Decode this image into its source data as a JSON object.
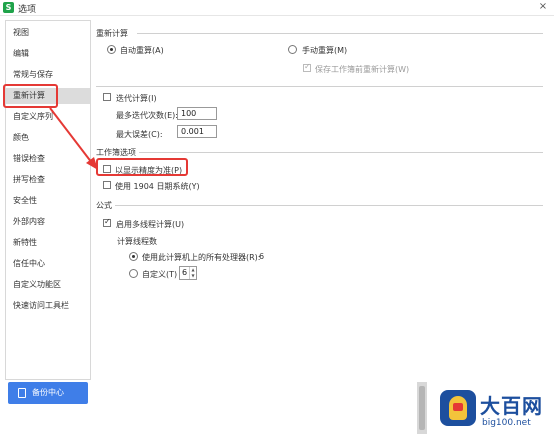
{
  "window": {
    "title": "选项",
    "app_icon_letter": "S",
    "close": "×"
  },
  "sidebar": {
    "items": [
      {
        "label": "视图",
        "active": false
      },
      {
        "label": "编辑",
        "active": false
      },
      {
        "label": "常规与保存",
        "active": false
      },
      {
        "label": "重新计算",
        "active": true
      },
      {
        "label": "自定义序列",
        "active": false
      },
      {
        "label": "颜色",
        "active": false
      },
      {
        "label": "错误检查",
        "active": false
      },
      {
        "label": "拼写检查",
        "active": false
      },
      {
        "label": "安全性",
        "active": false
      },
      {
        "label": "外部内容",
        "active": false
      },
      {
        "label": "新特性",
        "active": false
      },
      {
        "label": "信任中心",
        "active": false
      },
      {
        "label": "自定义功能区",
        "active": false
      },
      {
        "label": "快速访问工具栏",
        "active": false
      }
    ],
    "backup_button": "备份中心"
  },
  "recalc": {
    "title": "重新计算",
    "auto_label": "自动重算(A)",
    "auto_checked": true,
    "manual_label": "手动重算(M)",
    "manual_checked": false,
    "save_recalc_label": "保存工作簿前重新计算(W)",
    "save_recalc_checked": true
  },
  "iteration": {
    "label": "迭代计算(I)",
    "checked": false,
    "max_iter_label": "最多迭代次数(E):",
    "max_iter_value": "100",
    "max_change_label": "最大误差(C):",
    "max_change_value": "0.001"
  },
  "workbook": {
    "title": "工作簿选项",
    "precision_label": "以显示精度为准(P)",
    "precision_checked": false,
    "date1904_label": "使用 1904 日期系统(Y)",
    "date1904_checked": false
  },
  "formula": {
    "title": "公式",
    "multithread_label": "启用多线程计算(U)",
    "multithread_checked": true,
    "threads_title": "计算线程数",
    "all_proc_label": "使用此计算机上的所有处理器(R):",
    "all_proc_value": "6",
    "all_proc_checked": true,
    "manual_label": "自定义(T)",
    "manual_checked": false,
    "manual_value": "6"
  },
  "watermark": {
    "big": "大百网",
    "small": "big100.net"
  },
  "colors": {
    "accent": "#3f7ee8",
    "highlight": "#e53935",
    "active_bg": "#dcdcdc"
  }
}
